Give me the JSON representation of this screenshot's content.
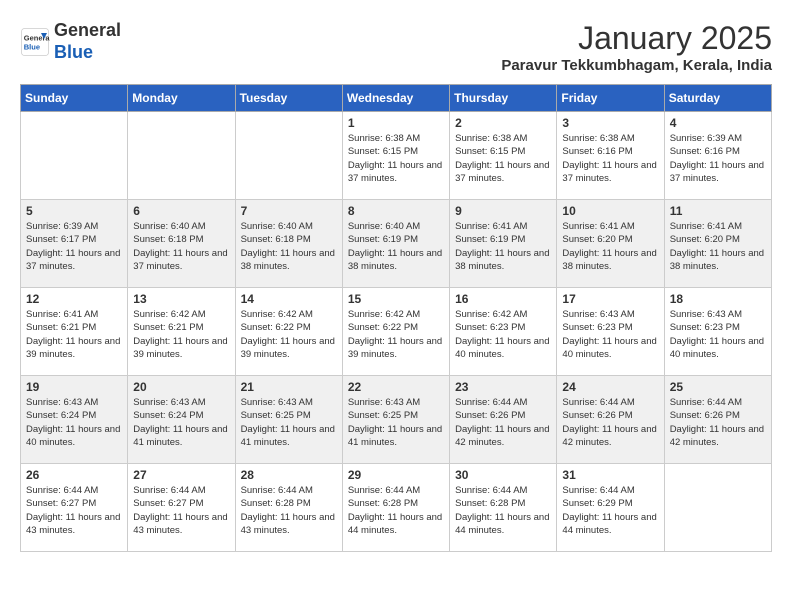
{
  "header": {
    "logo_general": "General",
    "logo_blue": "Blue",
    "month": "January 2025",
    "location": "Paravur Tekkumbhagam, Kerala, India"
  },
  "weekdays": [
    "Sunday",
    "Monday",
    "Tuesday",
    "Wednesday",
    "Thursday",
    "Friday",
    "Saturday"
  ],
  "weeks": [
    [
      {
        "day": "",
        "info": ""
      },
      {
        "day": "",
        "info": ""
      },
      {
        "day": "",
        "info": ""
      },
      {
        "day": "1",
        "info": "Sunrise: 6:38 AM\nSunset: 6:15 PM\nDaylight: 11 hours\nand 37 minutes."
      },
      {
        "day": "2",
        "info": "Sunrise: 6:38 AM\nSunset: 6:15 PM\nDaylight: 11 hours\nand 37 minutes."
      },
      {
        "day": "3",
        "info": "Sunrise: 6:38 AM\nSunset: 6:16 PM\nDaylight: 11 hours\nand 37 minutes."
      },
      {
        "day": "4",
        "info": "Sunrise: 6:39 AM\nSunset: 6:16 PM\nDaylight: 11 hours\nand 37 minutes."
      }
    ],
    [
      {
        "day": "5",
        "info": "Sunrise: 6:39 AM\nSunset: 6:17 PM\nDaylight: 11 hours\nand 37 minutes."
      },
      {
        "day": "6",
        "info": "Sunrise: 6:40 AM\nSunset: 6:18 PM\nDaylight: 11 hours\nand 37 minutes."
      },
      {
        "day": "7",
        "info": "Sunrise: 6:40 AM\nSunset: 6:18 PM\nDaylight: 11 hours\nand 38 minutes."
      },
      {
        "day": "8",
        "info": "Sunrise: 6:40 AM\nSunset: 6:19 PM\nDaylight: 11 hours\nand 38 minutes."
      },
      {
        "day": "9",
        "info": "Sunrise: 6:41 AM\nSunset: 6:19 PM\nDaylight: 11 hours\nand 38 minutes."
      },
      {
        "day": "10",
        "info": "Sunrise: 6:41 AM\nSunset: 6:20 PM\nDaylight: 11 hours\nand 38 minutes."
      },
      {
        "day": "11",
        "info": "Sunrise: 6:41 AM\nSunset: 6:20 PM\nDaylight: 11 hours\nand 38 minutes."
      }
    ],
    [
      {
        "day": "12",
        "info": "Sunrise: 6:41 AM\nSunset: 6:21 PM\nDaylight: 11 hours\nand 39 minutes."
      },
      {
        "day": "13",
        "info": "Sunrise: 6:42 AM\nSunset: 6:21 PM\nDaylight: 11 hours\nand 39 minutes."
      },
      {
        "day": "14",
        "info": "Sunrise: 6:42 AM\nSunset: 6:22 PM\nDaylight: 11 hours\nand 39 minutes."
      },
      {
        "day": "15",
        "info": "Sunrise: 6:42 AM\nSunset: 6:22 PM\nDaylight: 11 hours\nand 39 minutes."
      },
      {
        "day": "16",
        "info": "Sunrise: 6:42 AM\nSunset: 6:23 PM\nDaylight: 11 hours\nand 40 minutes."
      },
      {
        "day": "17",
        "info": "Sunrise: 6:43 AM\nSunset: 6:23 PM\nDaylight: 11 hours\nand 40 minutes."
      },
      {
        "day": "18",
        "info": "Sunrise: 6:43 AM\nSunset: 6:23 PM\nDaylight: 11 hours\nand 40 minutes."
      }
    ],
    [
      {
        "day": "19",
        "info": "Sunrise: 6:43 AM\nSunset: 6:24 PM\nDaylight: 11 hours\nand 40 minutes."
      },
      {
        "day": "20",
        "info": "Sunrise: 6:43 AM\nSunset: 6:24 PM\nDaylight: 11 hours\nand 41 minutes."
      },
      {
        "day": "21",
        "info": "Sunrise: 6:43 AM\nSunset: 6:25 PM\nDaylight: 11 hours\nand 41 minutes."
      },
      {
        "day": "22",
        "info": "Sunrise: 6:43 AM\nSunset: 6:25 PM\nDaylight: 11 hours\nand 41 minutes."
      },
      {
        "day": "23",
        "info": "Sunrise: 6:44 AM\nSunset: 6:26 PM\nDaylight: 11 hours\nand 42 minutes."
      },
      {
        "day": "24",
        "info": "Sunrise: 6:44 AM\nSunset: 6:26 PM\nDaylight: 11 hours\nand 42 minutes."
      },
      {
        "day": "25",
        "info": "Sunrise: 6:44 AM\nSunset: 6:26 PM\nDaylight: 11 hours\nand 42 minutes."
      }
    ],
    [
      {
        "day": "26",
        "info": "Sunrise: 6:44 AM\nSunset: 6:27 PM\nDaylight: 11 hours\nand 43 minutes."
      },
      {
        "day": "27",
        "info": "Sunrise: 6:44 AM\nSunset: 6:27 PM\nDaylight: 11 hours\nand 43 minutes."
      },
      {
        "day": "28",
        "info": "Sunrise: 6:44 AM\nSunset: 6:28 PM\nDaylight: 11 hours\nand 43 minutes."
      },
      {
        "day": "29",
        "info": "Sunrise: 6:44 AM\nSunset: 6:28 PM\nDaylight: 11 hours\nand 44 minutes."
      },
      {
        "day": "30",
        "info": "Sunrise: 6:44 AM\nSunset: 6:28 PM\nDaylight: 11 hours\nand 44 minutes."
      },
      {
        "day": "31",
        "info": "Sunrise: 6:44 AM\nSunset: 6:29 PM\nDaylight: 11 hours\nand 44 minutes."
      },
      {
        "day": "",
        "info": ""
      }
    ]
  ]
}
